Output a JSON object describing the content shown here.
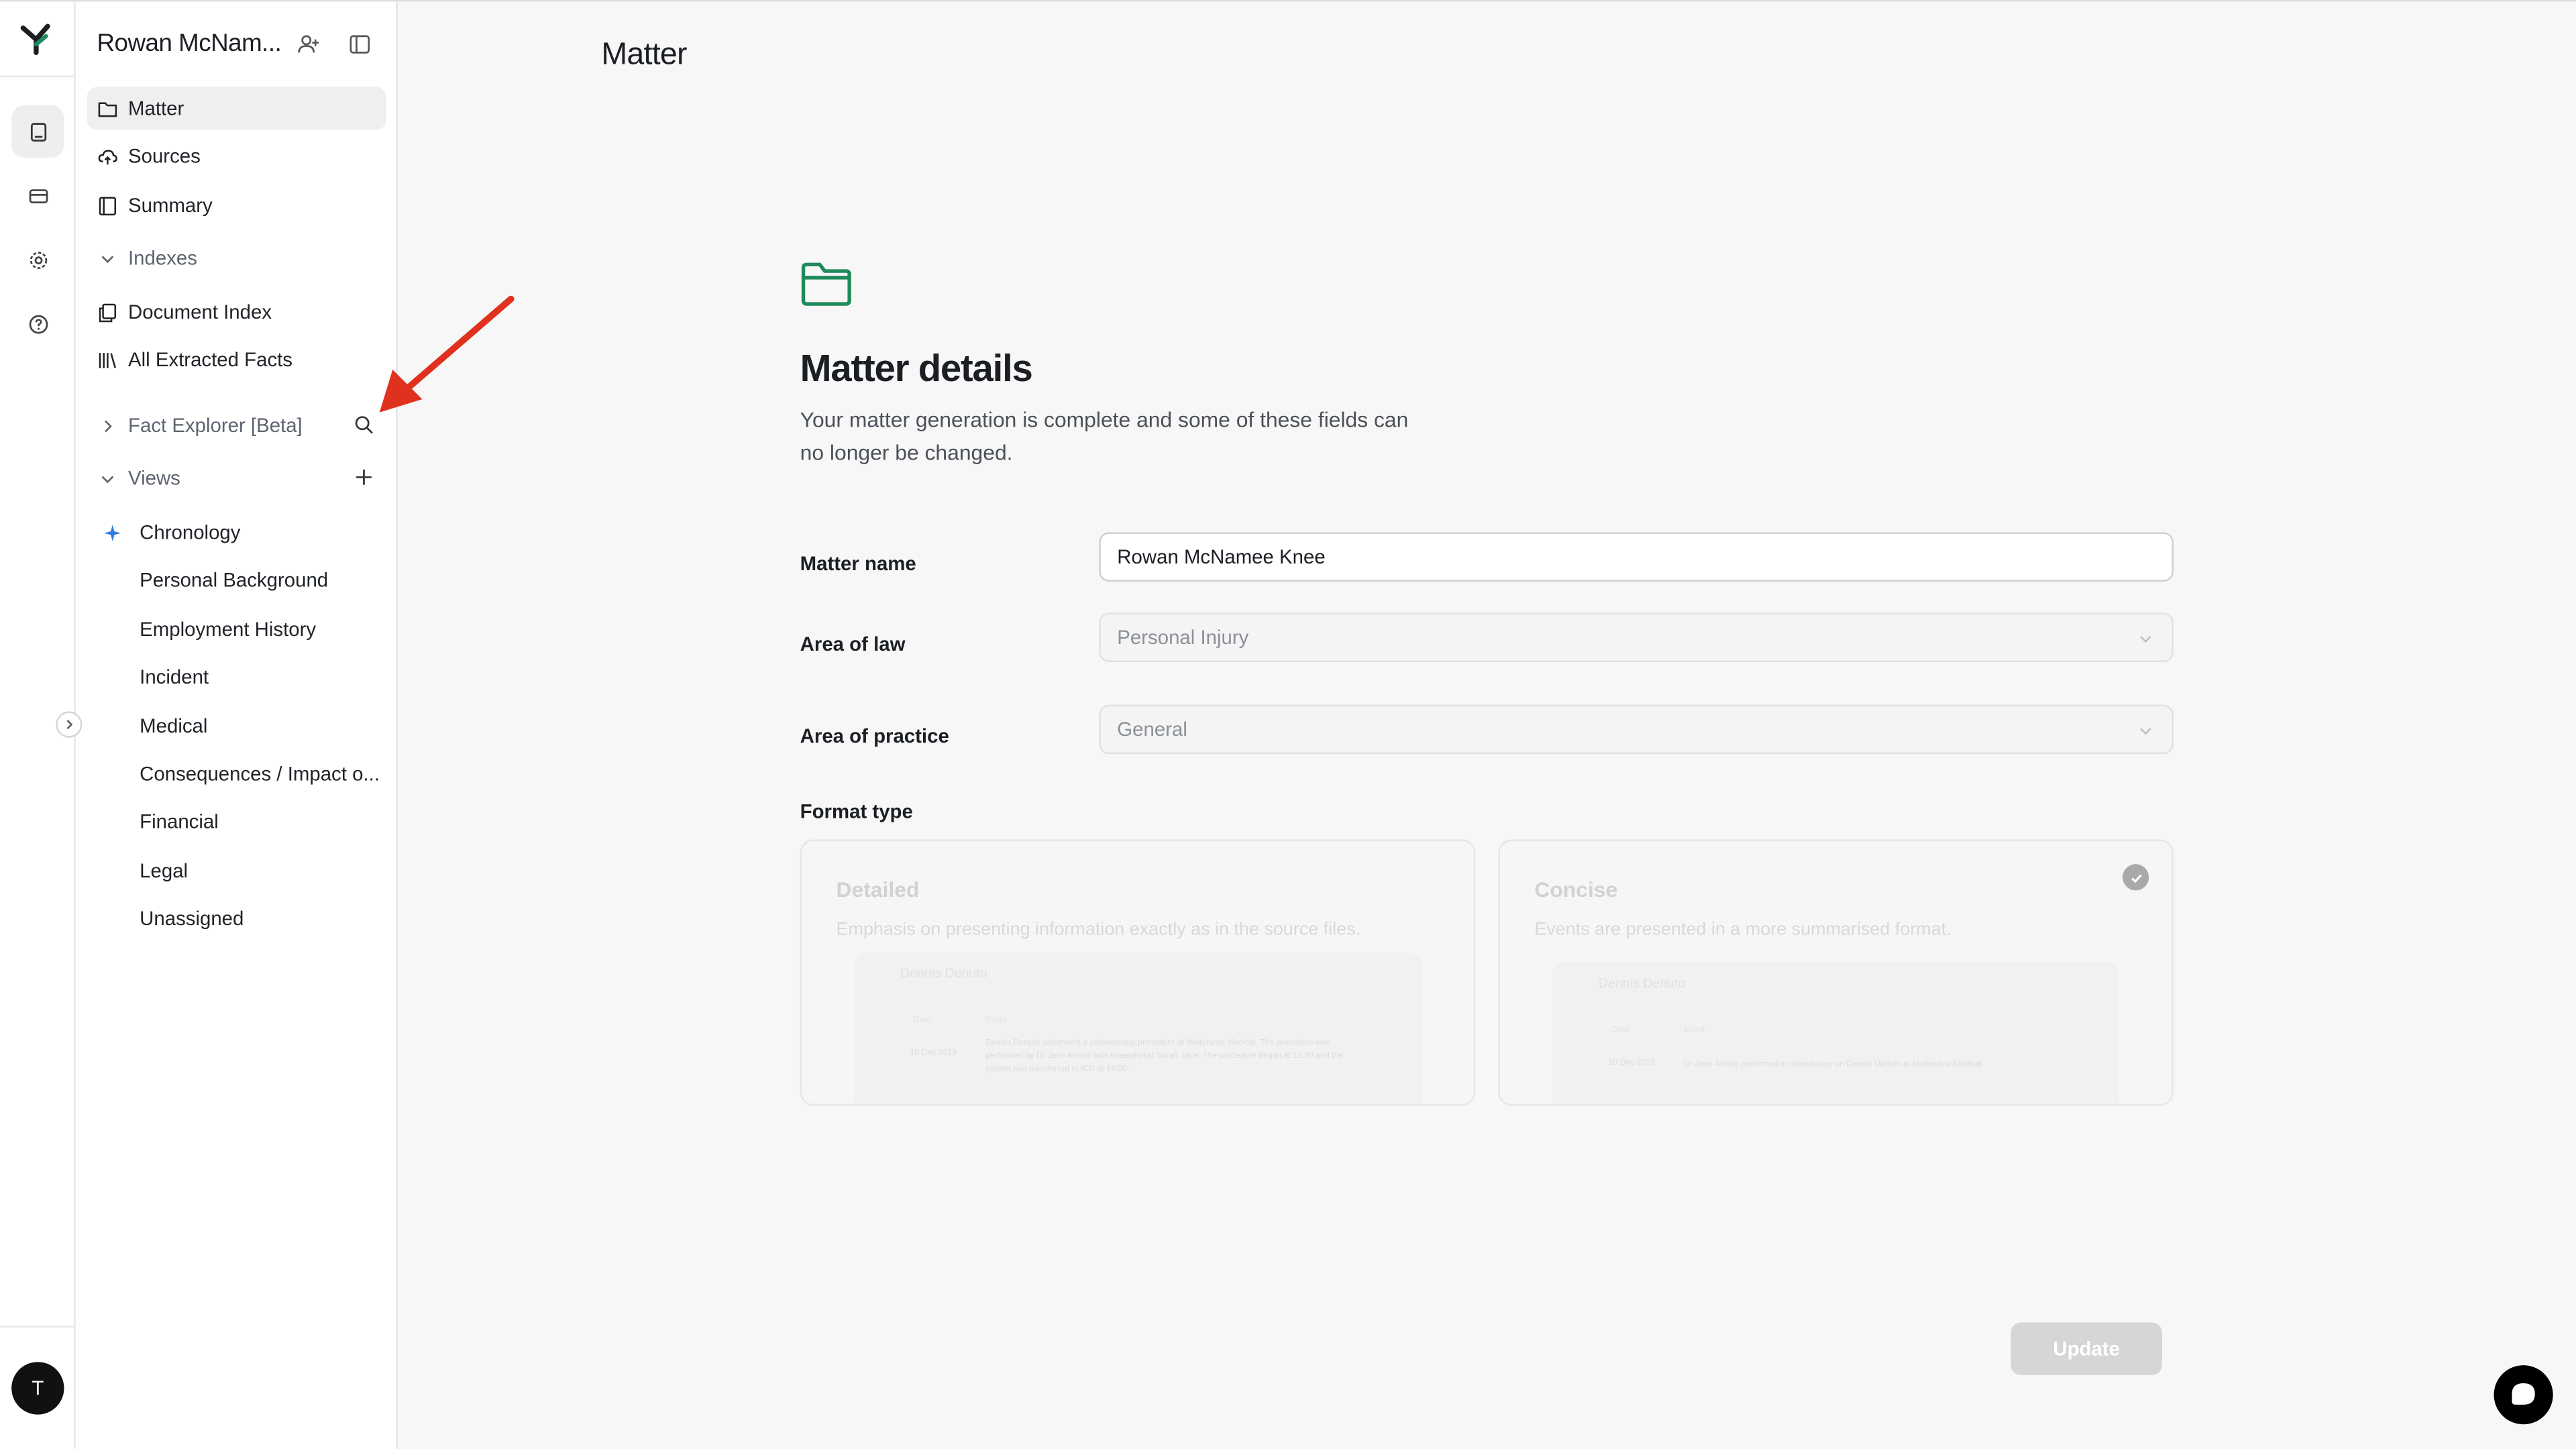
{
  "rail": {
    "icons": [
      "logo-icon",
      "book-icon",
      "card-icon",
      "gear-icon",
      "help-icon"
    ],
    "avatar_initial": "T"
  },
  "sidebar": {
    "title": "Rowan McNam...",
    "items": [
      {
        "label": "Matter",
        "icon": "folder-icon"
      },
      {
        "label": "Sources",
        "icon": "cloud-upload-icon"
      },
      {
        "label": "Summary",
        "icon": "notebook-icon"
      },
      {
        "label": "Indexes",
        "icon": "chevron-down-icon"
      },
      {
        "label": "Document Index",
        "icon": "copy-icon"
      },
      {
        "label": "All Extracted Facts",
        "icon": "library-icon"
      },
      {
        "label": "Fact Explorer [Beta]",
        "icon": "chevron-right-icon"
      },
      {
        "label": "Views",
        "icon": "chevron-down-icon"
      }
    ],
    "views": [
      "Chronology",
      "Personal Background",
      "Employment History",
      "Incident",
      "Medical",
      "Consequences / Impact o...",
      "Financial",
      "Legal",
      "Unassigned"
    ]
  },
  "main": {
    "title": "Matter",
    "heading": "Matter details",
    "description": "Your matter generation is complete and some of these fields can no longer be changed.",
    "fields": {
      "matter_name_label": "Matter name",
      "matter_name_value": "Rowan McNamee Knee",
      "area_of_law_label": "Area of law",
      "area_of_law_value": "Personal Injury",
      "area_of_practice_label": "Area of practice",
      "area_of_practice_value": "General"
    },
    "format_type_label": "Format type",
    "formats": [
      {
        "title": "Detailed",
        "description": "Emphasis on presenting information exactly as in the source files.",
        "preview_name": "Dennis Denuto",
        "preview_col_date": "Date",
        "preview_col_event": "Event",
        "preview_date": "10 Dec 2019",
        "preview_text": "Dennis Denuto underwent a colonoscopy procedure at Melbourne Medical. The procedure was performed by Dr Jane Arnold with anaesthetist Sarah Jane. The procedure began at 13:00 and the patient was transferred to ICU at 14:00.",
        "selected": false
      },
      {
        "title": "Concise",
        "description": "Events are presented in a more summarised format.",
        "preview_name": "Dennis Denuto",
        "preview_col_date": "Date",
        "preview_col_event": "Event",
        "preview_date": "10 Dec 2019",
        "preview_text": "Dr Jane Arnold performed a colonoscopy on Dennis Denuto at Melbourne Medical.",
        "selected": true
      }
    ],
    "update_label": "Update"
  },
  "colors": {
    "accent_green": "#1f8a5b",
    "annotation_arrow": "#e0301e",
    "chronology_star": "#2f7de1"
  }
}
